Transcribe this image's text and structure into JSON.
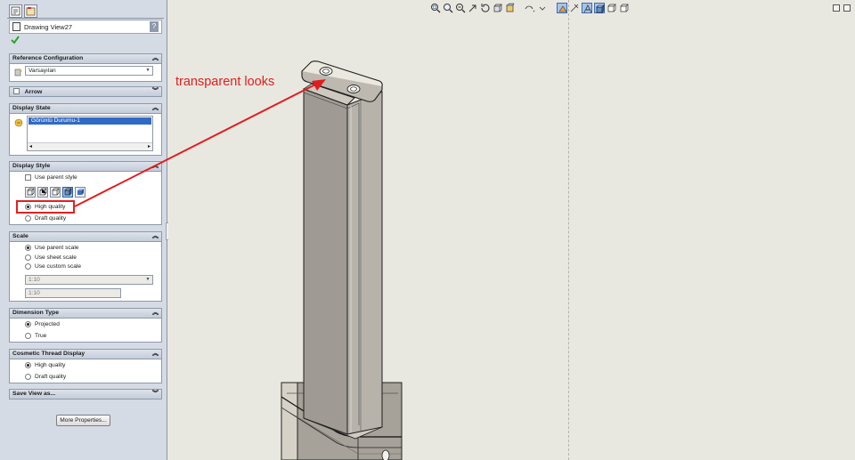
{
  "feature_title": "Drawing View27",
  "help_icon": "?",
  "reference_configuration": {
    "header": "Reference Configuration",
    "selected": "Varsayılan"
  },
  "arrow": {
    "header": "Arrow"
  },
  "display_state": {
    "header": "Display State",
    "items": [
      "Görüntü Durumu-1"
    ]
  },
  "display_style": {
    "header": "Display Style",
    "use_parent_style": "Use parent style",
    "style_buttons": [
      "wireframe",
      "hidden-lines-visible",
      "hidden-lines-removed",
      "shaded-with-edges",
      "shaded"
    ],
    "active_style": "shaded-with-edges",
    "quality_options": [
      "High quality",
      "Draft quality"
    ],
    "selected_quality": "High quality"
  },
  "scale": {
    "header": "Scale",
    "options": [
      "Use parent scale",
      "Use sheet scale",
      "Use custom scale"
    ],
    "selected": "Use parent scale",
    "custom_value": "1:10",
    "custom_text": "1:10"
  },
  "dimension_type": {
    "header": "Dimension Type",
    "options": [
      "Projected",
      "True"
    ],
    "selected": "Projected"
  },
  "cosmetic_thread": {
    "header": "Cosmetic Thread Display",
    "options": [
      "High quality",
      "Draft quality"
    ],
    "selected": "High quality"
  },
  "save_view": {
    "header": "Save View as..."
  },
  "more_properties": "More Properties...",
  "annotation": {
    "text": "transparent looks",
    "color": "#e01e1e"
  },
  "toolbar_icons": [
    "zoom-to-fit-icon",
    "zoom-area-icon",
    "zoom-in-out-icon",
    "pan-icon",
    "rotate-icon",
    "3d-view-icon",
    "section-view-icon",
    "view-orientation-icon",
    "display-style-icon",
    "hide-show-icon",
    "edit-appearance-icon",
    "apply-scene-icon",
    "view-settings-icon",
    "shaded-with-edges-icon",
    "shaded-icon"
  ]
}
